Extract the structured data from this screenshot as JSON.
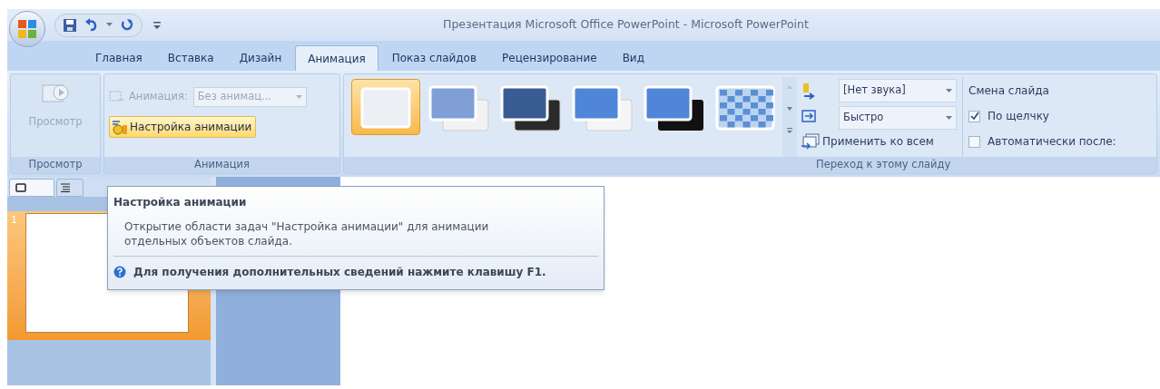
{
  "window": {
    "title": "Презентация Microsoft Office PowerPoint - Microsoft PowerPoint"
  },
  "tabs": [
    {
      "label": "Главная",
      "selected": false
    },
    {
      "label": "Вставка",
      "selected": false
    },
    {
      "label": "Дизайн",
      "selected": false
    },
    {
      "label": "Анимация",
      "selected": true
    },
    {
      "label": "Показ слайдов",
      "selected": false
    },
    {
      "label": "Рецензирование",
      "selected": false
    },
    {
      "label": "Вид",
      "selected": false
    }
  ],
  "groups": {
    "preview": {
      "button": "Просмотр",
      "label": "Просмотр"
    },
    "animation": {
      "animation_label": "Анимация:",
      "animation_value": "Без анимац...",
      "custom_button": "Настройка анимации",
      "label": "Анимация"
    },
    "transition": {
      "label": "Переход к этому слайду",
      "sound": "[Нет звука]",
      "speed": "Быстро",
      "apply_all": "Применить ко всем",
      "items": [
        {
          "kind": "plain",
          "selected": true
        },
        {
          "kind": "fade",
          "selected": false
        },
        {
          "kind": "dark",
          "selected": false
        },
        {
          "kind": "wipe",
          "selected": false
        },
        {
          "kind": "black",
          "selected": false
        },
        {
          "kind": "checker",
          "selected": false
        }
      ]
    },
    "advance": {
      "title": "Смена слайда",
      "on_click": {
        "label": "По щелчку",
        "checked": true
      },
      "auto": {
        "label": "Автоматически после:",
        "checked": false
      }
    }
  },
  "slides": [
    {
      "number": "1",
      "selected": true
    }
  ],
  "tooltip": {
    "title": "Настройка анимации",
    "body": "Открытие области задач \"Настройка анимации\" для анимации отдельных объектов слайда.",
    "help": "Для получения дополнительных сведений нажмите клавишу F1."
  }
}
